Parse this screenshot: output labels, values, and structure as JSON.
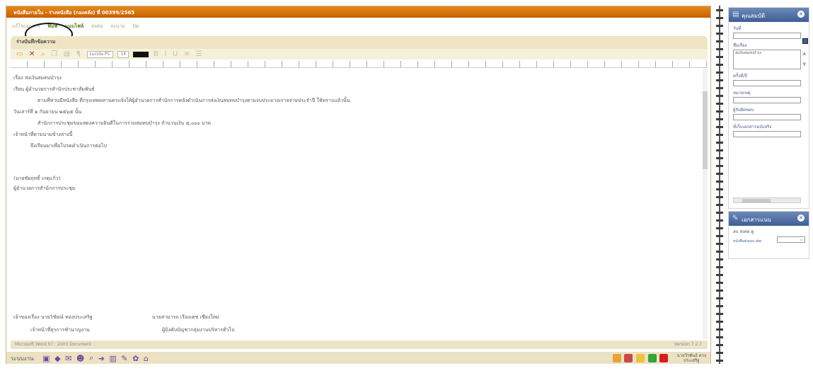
{
  "window": {
    "title": "หนังสือภายใน - ร่างหนังสือ (กองคลัง) ที่ 00399/2565",
    "menu": [
      "แก้ไขเอกสาร",
      "พิมพ์",
      "แนบไฟล์",
      "ส่งต่อ",
      "ลงนาม",
      "ปิด"
    ],
    "doc_title": "ร่างบันทึกข้อความ"
  },
  "toolbar": {
    "font_name": "Lucida PC",
    "font_size": "14",
    "icons": [
      "save-icon",
      "delete-icon",
      "find-icon",
      "copy-icon",
      "paste-icon",
      "format-icon"
    ]
  },
  "document": {
    "lines": [
      "เรื่อง ส่งเงินสมทบบำรุง",
      "เรียน ผู้อำนวยการสำนักประชาสัมพันธ์",
      "ตามที่ท่านมีหนังสือ ที่กรุงเทพมหานครแจ้งให้ผู้อำนวยการสำนักการคลังดำเนินการส่งเงินสมทบบำรุงตามงบประมาณรายจ่ายประจำปี ให้ทราบแล้วนั้น",
      "วันเสาร์ที่ ๑ กันยายน ๒๕๖๕ นั้น",
      "สำนักการประชุมขอแสดงความยินดีในการร่วมสมทบบำรุง จำนวนเงิน ๕,๐๐๐ บาท",
      "เจ้าหน้าที่ตามนามข้างล่างนี้",
      "จึงเรียนมาเพื่อโปรดดำเนินการต่อไป",
      "(นายชัยฤทธิ์ เกตุแก้ว)",
      "ผู้อำนวยการสำนักการประชุม",
      "เจ้าของเรื่อง นายวิชัยณ์ ทองประเสริฐ",
      "นายสามารถ เรืองเดช เชียงใหม่",
      "เจ้าหน้าที่ธุรการชำนาญงาน",
      "ผู้บังคับบัญชากลุ่มงานบริหารทั่วไป"
    ]
  },
  "status": {
    "left_text": "Microsoft Word 97 · 2003 Document",
    "version": "Version 7.2.7"
  },
  "taskbar": {
    "label": "ระบบงาน",
    "user_line1": "นายวีรพันธ์ ดวง",
    "user_line2": "ประเสริฐ"
  },
  "properties_panel": {
    "title": "คุณสมบัติ",
    "date_label": "วันที่",
    "subject_label": "ชื่อเรื่อง",
    "subject_value": "ส่งเงินสมทบบำรุง",
    "deadline_label": "ครั้งที่/ปี",
    "note_label": "หมายเหตุ",
    "owner_label": "ผู้รับผิดชอบ",
    "keeper_label": "ที่เก็บเอกสารฉบับจริง"
  },
  "attach_panel": {
    "title": "เอกสารแนบ",
    "actions": "ลบ  ส่งต่อ  ดู",
    "item": "หนังสือส่งมอบ.doc"
  }
}
